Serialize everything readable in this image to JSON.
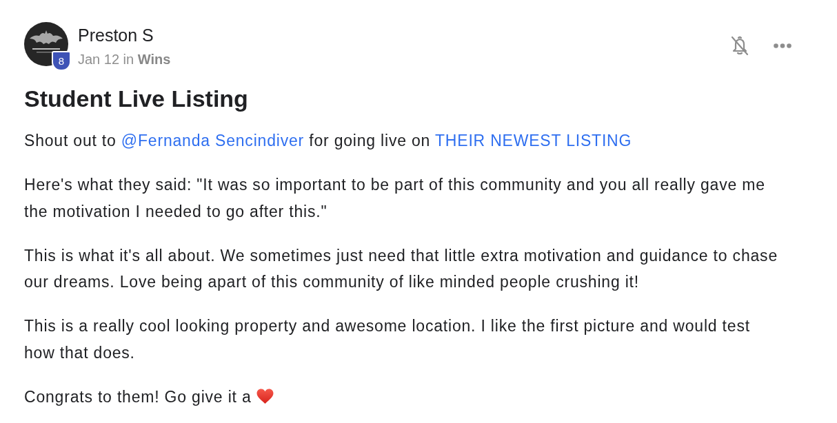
{
  "post": {
    "author": {
      "name": "Preston S",
      "badge": "8",
      "meta": "Jan 12 in **Wins**"
    },
    "actions": [
      {
        "kind": "bell-off"
      },
      {
        "kind": "more"
      }
    ],
    "title": "Student Live Listing",
    "paragraphs": [
      {
        "segments": [
          {
            "kind": "text",
            "text": "Shout out to "
          },
          {
            "kind": "mention",
            "text": "@Fernanda Sencindiver"
          },
          {
            "kind": "text",
            "text": " for going live on "
          },
          {
            "kind": "link",
            "text": "THEIR NEWEST LISTING"
          }
        ]
      },
      {
        "segments": [
          {
            "kind": "text",
            "text": "Here's what they said: \"It was so important to be part of this community and you all really gave me the motivation I needed to go after this.\""
          }
        ]
      },
      {
        "segments": [
          {
            "kind": "text",
            "text": "This is what it's all about. We sometimes just need that little extra motivation and guidance to chase our dreams. Love being apart of this community of like minded people crushing it!"
          }
        ]
      },
      {
        "segments": [
          {
            "kind": "text",
            "text": "This is a really cool looking property and awesome location. I like the first picture and would test how that does."
          }
        ]
      },
      {
        "segments": [
          {
            "kind": "text",
            "text": "Congrats to them! Go give it a "
          },
          {
            "kind": "heart"
          }
        ]
      }
    ]
  }
}
